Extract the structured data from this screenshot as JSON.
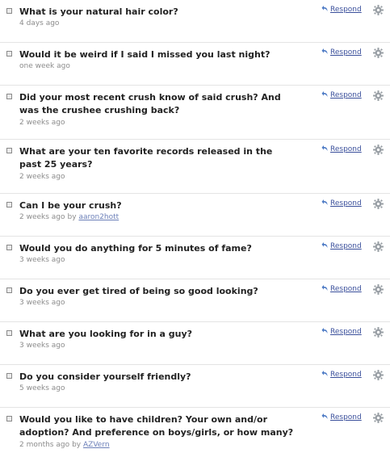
{
  "respond_label": "Respond",
  "by_label": "by",
  "questions": [
    {
      "text": "What is your natural hair color?",
      "time": "4 days ago",
      "author": ""
    },
    {
      "text": "Would it be weird if I said I missed you last night?",
      "time": "one week ago",
      "author": ""
    },
    {
      "text": "Did your most recent crush know of said crush? And was the crushee crushing back?",
      "time": "2 weeks ago",
      "author": ""
    },
    {
      "text": "What are your ten favorite records released in the past 25 years?",
      "time": "2 weeks ago",
      "author": ""
    },
    {
      "text": "Can I be your crush?",
      "time": "2 weeks ago",
      "author": "aaron2hott"
    },
    {
      "text": "Would you do anything for 5 minutes of fame?",
      "time": "3 weeks ago",
      "author": ""
    },
    {
      "text": "Do you ever get tired of being so good looking?",
      "time": "3 weeks ago",
      "author": ""
    },
    {
      "text": "What are you looking for in a guy?",
      "time": "3 weeks ago",
      "author": ""
    },
    {
      "text": "Do you consider yourself friendly?",
      "time": "5 weeks ago",
      "author": ""
    },
    {
      "text": "Would you like to have children? Your own and/or adoption? And preference on boys/girls, or how many?",
      "time": "2 months ago",
      "author": "AZVern"
    }
  ],
  "colors": {
    "link": "#3a4f9b",
    "author_link": "#6b7fb8",
    "meta": "#8c8c8c"
  },
  "icons": {
    "respond": "respond-arrow-icon",
    "options": "gear-icon"
  }
}
